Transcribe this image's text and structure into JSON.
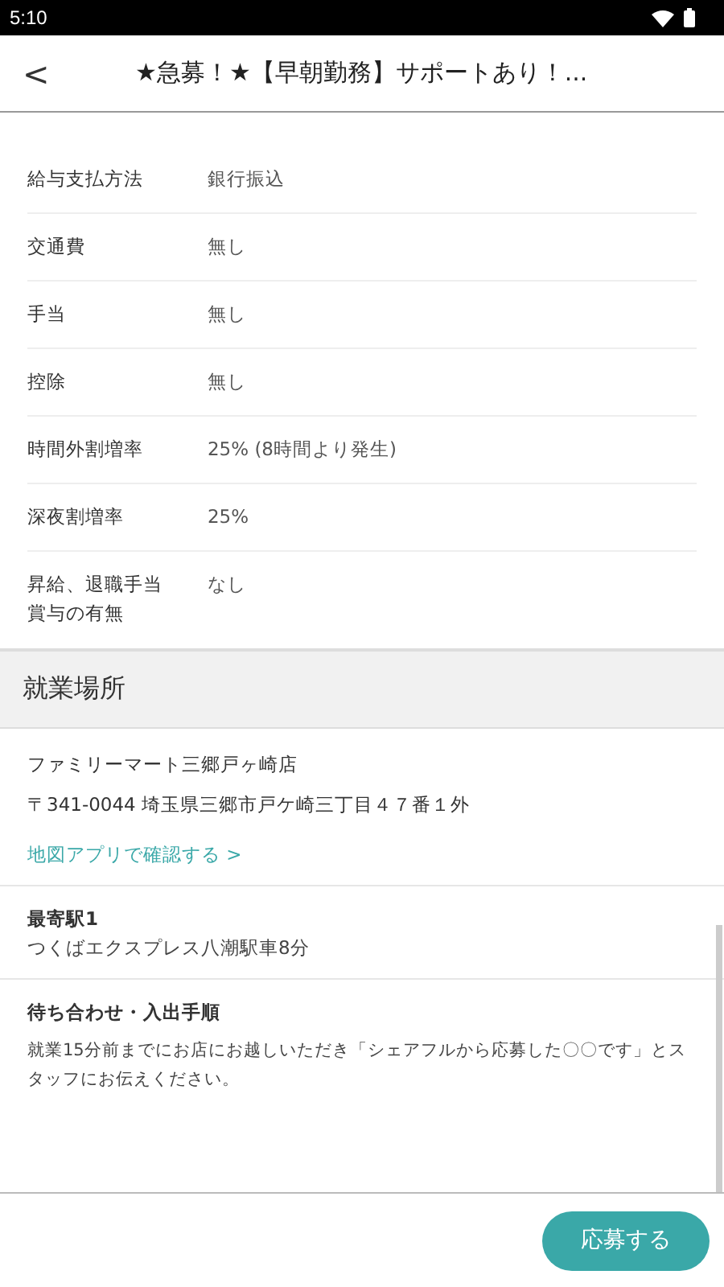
{
  "status_bar": {
    "time": "5:10"
  },
  "header": {
    "back": "<",
    "title": "★急募！★【早朝勤務】サポートあり！..."
  },
  "details": [
    {
      "label": "給与支払方法",
      "value": "銀行振込"
    },
    {
      "label": "交通費",
      "value": "無し"
    },
    {
      "label": "手当",
      "value": "無し"
    },
    {
      "label": "控除",
      "value": "無し"
    },
    {
      "label": "時間外割増率",
      "value": "25% (8時間より発生)"
    },
    {
      "label": "深夜割増率",
      "value": "25%"
    },
    {
      "label": "昇給、退職手当賞与の有無",
      "value": "なし"
    }
  ],
  "workplace": {
    "heading": "就業場所",
    "store": "ファミリーマート三郷戸ヶ崎店",
    "address": "〒341-0044 埼玉県三郷市戸ケ崎三丁目４７番１外",
    "map_link": "地図アプリで確認する >",
    "station_label": "最寄駅1",
    "station": "つくばエクスプレス八潮駅車8分",
    "meeting_label": "待ち合わせ・入出手順",
    "meeting": "就業15分前までにお店にお越しいただき「シェアフルから応募した〇〇です」とスタッフにお伝えください。"
  },
  "apply_button": "応募する"
}
